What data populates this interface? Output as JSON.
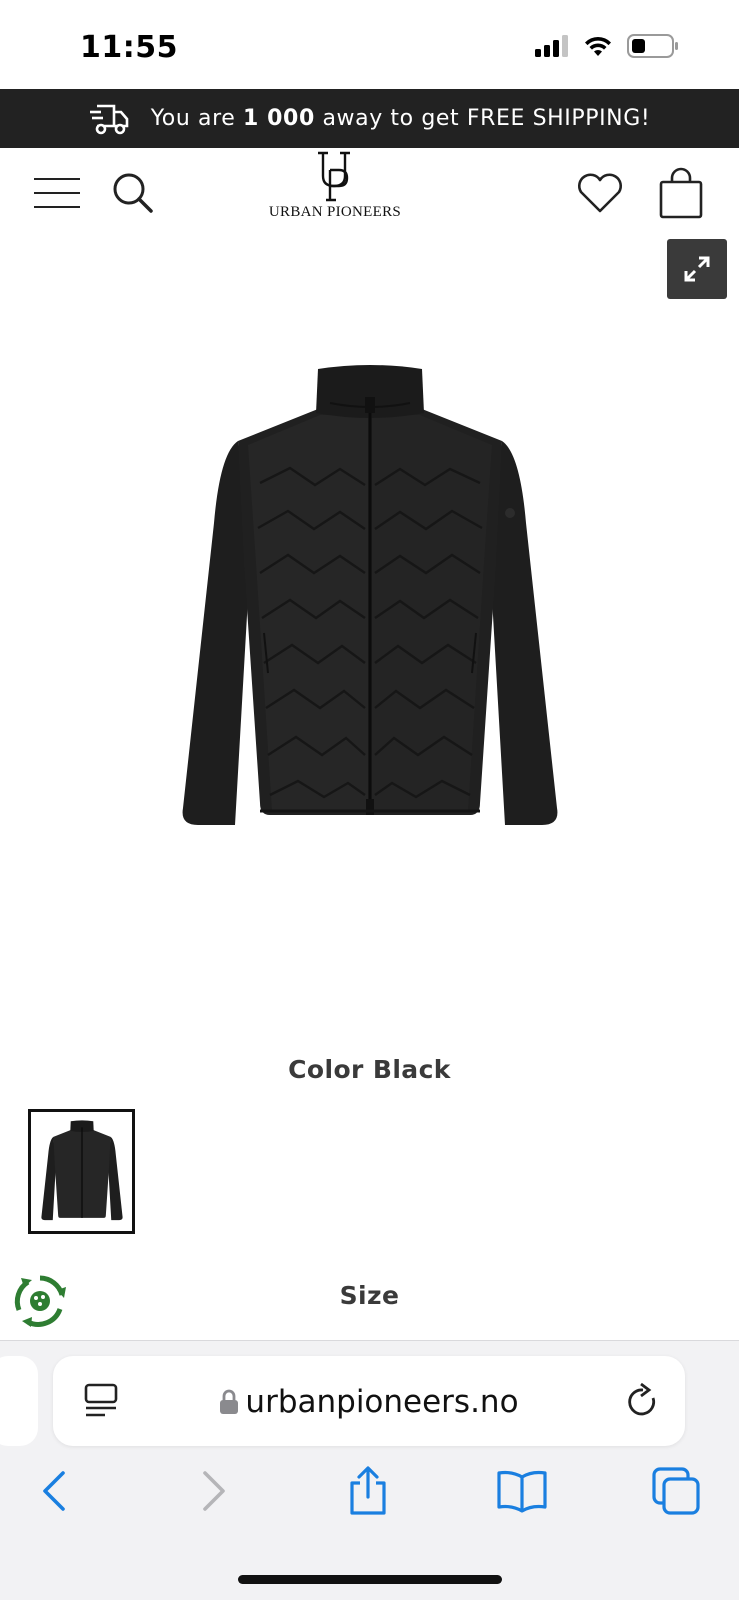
{
  "status_bar": {
    "time": "11:55",
    "icons": [
      "cellular-signal-icon",
      "wifi-icon",
      "battery-icon"
    ]
  },
  "promo": {
    "icon": "delivery-truck-icon",
    "text_before": "You are ",
    "amount": "1 000",
    "text_after": " away to get FREE SHIPPING!"
  },
  "header": {
    "menu_icon": "hamburger-menu-icon",
    "search_icon": "search-icon",
    "logo_monogram": "UP",
    "logo_text": "URBAN PIONEERS",
    "wishlist_icon": "heart-icon",
    "cart_icon": "shopping-bag-icon"
  },
  "product": {
    "expand_icon": "expand-icon",
    "image_alt": "Black quilted hybrid jacket",
    "color_label": "Color Black",
    "thumbnail_count": 1,
    "size_label": "Size",
    "eco_badge_icon": "recycle-badge-icon"
  },
  "browser": {
    "url": "urbanpioneers.no",
    "reader_icon": "reader-view-icon",
    "lock_icon": "lock-icon",
    "reload_icon": "reload-icon",
    "toolbar": [
      "back-icon",
      "forward-icon",
      "share-icon",
      "bookmarks-icon",
      "tabs-icon"
    ]
  },
  "colors": {
    "promo_bg": "#222222",
    "browser_accent": "#1a7fe0",
    "eco_green": "#2e7d32"
  }
}
